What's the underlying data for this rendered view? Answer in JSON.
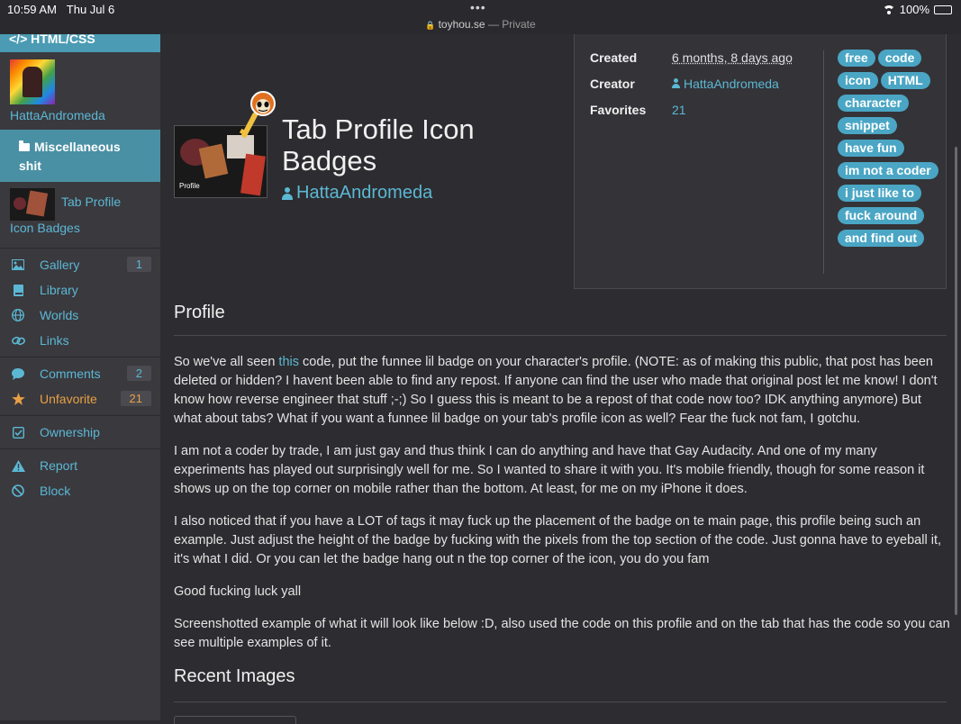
{
  "statusbar": {
    "time": "10:59 AM",
    "date": "Thu Jul 6",
    "dots": "•••",
    "domain": "toyhou.se",
    "privacy": "— Private",
    "battery": "100%",
    "battery_level": 1.0
  },
  "sidebar": {
    "section_title": "</> HTML/CSS",
    "username": "HattaAndromeda",
    "folder": {
      "line1": "Miscellaneous",
      "line2": "shit"
    },
    "tab": {
      "line1": "Tab Profile",
      "line2": "Icon Badges"
    },
    "nav1": [
      {
        "label": "Gallery",
        "count": "1",
        "icon": "image-icon"
      },
      {
        "label": "Library",
        "icon": "book-icon"
      },
      {
        "label": "Worlds",
        "icon": "globe-icon"
      },
      {
        "label": "Links",
        "icon": "link-icon"
      }
    ],
    "nav2": [
      {
        "label": "Comments",
        "count": "2",
        "icon": "comment-icon"
      },
      {
        "label": "Unfavorite",
        "count": "21",
        "icon": "star-icon"
      }
    ],
    "nav3": [
      {
        "label": "Ownership",
        "icon": "check-square-icon"
      }
    ],
    "nav4": [
      {
        "label": "Report",
        "icon": "warning-icon"
      },
      {
        "label": "Block",
        "icon": "block-icon"
      }
    ]
  },
  "header": {
    "title_line1": "Tab Profile Icon",
    "title_line2": "Badges",
    "owner": "HattaAndromeda",
    "icon_label": "Profile"
  },
  "info": {
    "created_label": "Created",
    "created_value": "6 months, 8 days ago",
    "creator_label": "Creator",
    "creator_value": "HattaAndromeda",
    "favorites_label": "Favorites",
    "favorites_value": "21"
  },
  "tags": [
    "free",
    "code",
    "icon",
    "HTML",
    "character",
    "snippet",
    "have fun",
    "im not a coder",
    "i just like to",
    "fuck around",
    "and find out"
  ],
  "profile": {
    "heading": "Profile",
    "p1_before": "So we've all seen ",
    "p1_link": "this",
    "p1_after": " code, put the funnee lil badge on your character's profile. (NOTE: as of making this public, that post has been deleted or hidden? I havent been able to find any repost. If anyone can find the user who made that original post let me know! I don't know how reverse engineer that stuff ;-;) So I guess this is meant to be a repost of that code now too? IDK anything anymore) But what about tabs? What if you want a funnee lil badge on your tab's profile icon as well? Fear the fuck not fam, I gotchu.",
    "p2": "I am not a coder by trade, I am just gay and thus think I can do anything and have that Gay Audacity. And one of my many experiments has played out surprisingly well for me. So I wanted to share it with you. It's mobile friendly, though for some reason it shows up on the top corner on mobile rather than the bottom. At least, for me on my iPhone it does.",
    "p3": "I also noticed that if you have a LOT of tags it may fuck up the placement of the badge on te main page, this profile being such an example. Just adjust the height of the badge by fucking with the pixels from the top section of the code. Just gonna have to eyeball it, it's what I did. Or you can let the badge hang out n the top corner of the icon, you do you fam",
    "p4": "Good fucking luck yall",
    "p5": "Screenshotted example of what it will look like below :D, also used the code on this profile and on the tab that has the code so you can see multiple examples of it."
  },
  "recent_images": {
    "heading": "Recent Images"
  }
}
